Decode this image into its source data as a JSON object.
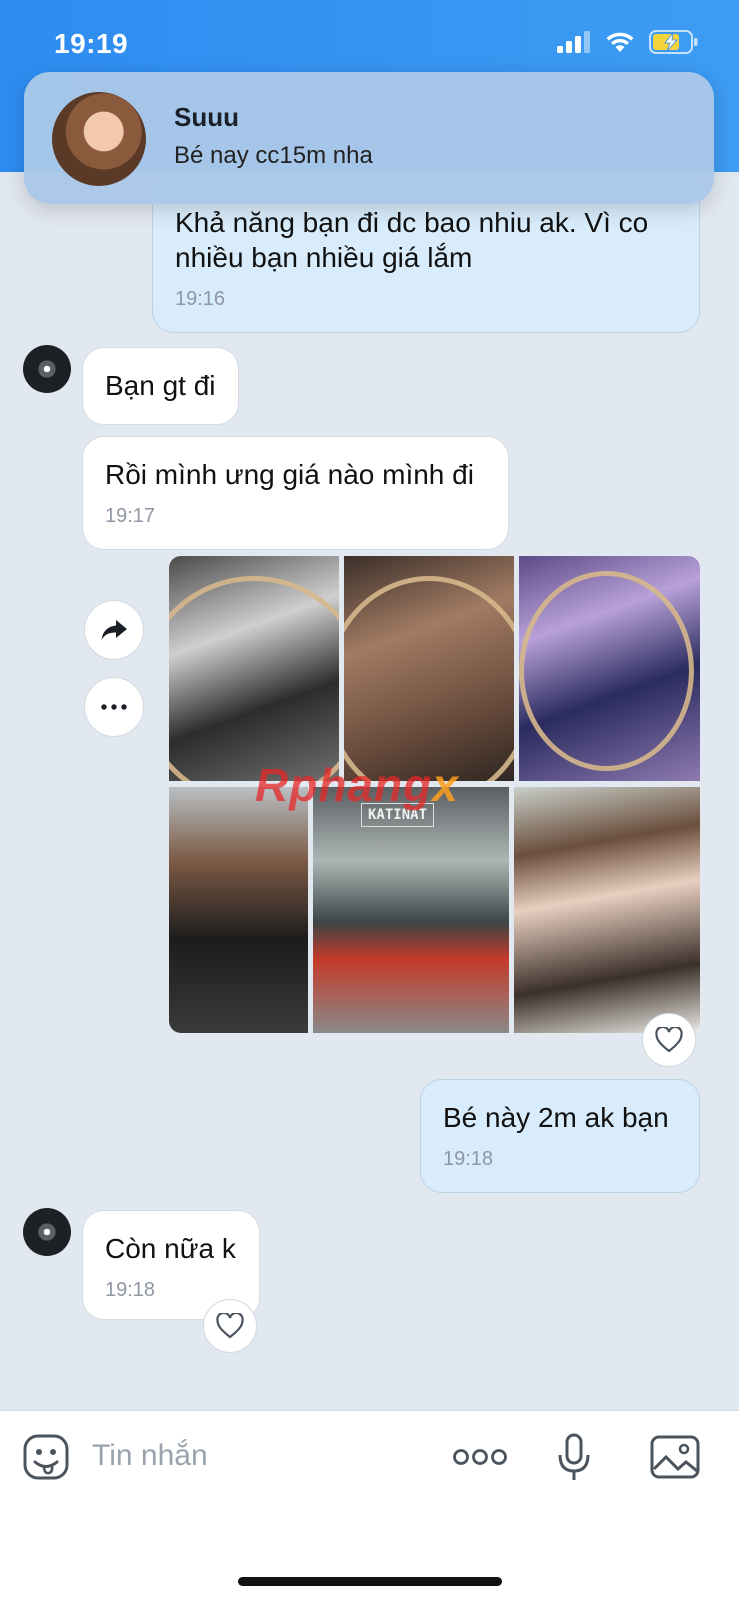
{
  "status_bar": {
    "time": "19:19"
  },
  "notification": {
    "sender": "Suuu",
    "message": "Bé nay cc15m nha"
  },
  "messages": [
    {
      "text": "Khả năng bạn đi dc bao nhiu ak. Vì co nhiều bạn nhiều giá lắm",
      "time": "19:16"
    },
    {
      "text": "Bạn gt đi"
    },
    {
      "text": "Rồi mình ưng giá nào mình đi",
      "time": "19:17"
    },
    {
      "text": "Bé này 2m ak bạn",
      "time": "19:18"
    },
    {
      "text": "Còn nữa k",
      "time": "19:18"
    }
  ],
  "photo_grid": {
    "count": 6
  },
  "store_sign": "KATINAT",
  "watermark": {
    "text": "Rphang",
    "accent": "x"
  },
  "composer": {
    "placeholder": "Tin nhắn"
  },
  "colors": {
    "header": "#2d8cf0",
    "outgoing_bubble": "#d8ecfb",
    "incoming_bubble": "#ffffff",
    "background": "#e2e8f0"
  },
  "icons": [
    "signal-icon",
    "wifi-icon",
    "battery-charging-icon",
    "forward-icon",
    "more-icon",
    "heart-icon",
    "sticker-icon",
    "more-options-icon",
    "microphone-icon",
    "image-icon"
  ]
}
